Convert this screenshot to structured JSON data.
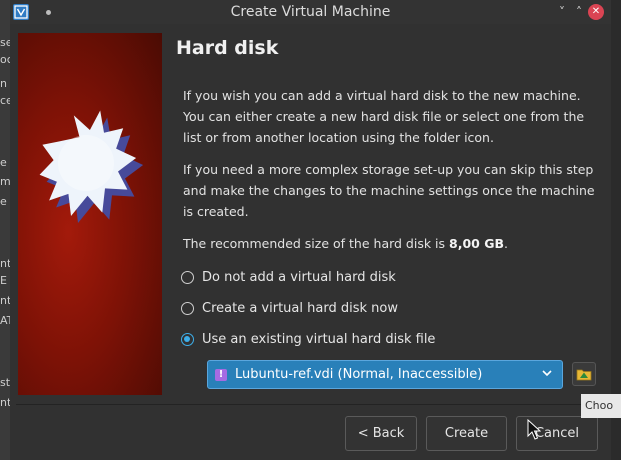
{
  "window": {
    "title": "Create Virtual Machine",
    "minimize_glyph": "˅",
    "maximize_glyph": "˄",
    "close_glyph": "✕"
  },
  "background_app": {
    "fragments": [
      "se",
      "oc",
      "n",
      "ce",
      "e",
      "m",
      "e",
      "nt",
      "E",
      "nt",
      "AT",
      "st",
      "nt"
    ]
  },
  "page": {
    "heading": "Hard disk",
    "intro": "If you wish you can add a virtual hard disk to the new machine. You can either create a new hard disk file or select one from the list or from another location using the folder icon.",
    "advanced": "If you need a more complex storage set-up you can skip this step and make the changes to the machine settings once the machine is created.",
    "recommend_prefix": "The recommended size of the hard disk is ",
    "recommend_size": "8,00 GB",
    "recommend_suffix": "."
  },
  "options": [
    {
      "label": "Do not add a virtual hard disk",
      "checked": false
    },
    {
      "label": "Create a virtual hard disk now",
      "checked": false
    },
    {
      "label": "Use an existing virtual hard disk file",
      "checked": true
    }
  ],
  "disk_select": {
    "value": "Lubuntu-ref.vdi (Normal, Inaccessible)",
    "status_icon": "warning-icon",
    "status_glyph": "!"
  },
  "folder_button": {
    "icon": "folder-icon"
  },
  "tooltip": {
    "text": "Choo"
  },
  "buttons": {
    "back": "< Back",
    "create": "Create",
    "cancel": "Cancel"
  },
  "colors": {
    "accent": "#3daee9",
    "selected_combo": "#2980b9",
    "close_button": "#da4453",
    "art_red": "#a31a0b"
  }
}
